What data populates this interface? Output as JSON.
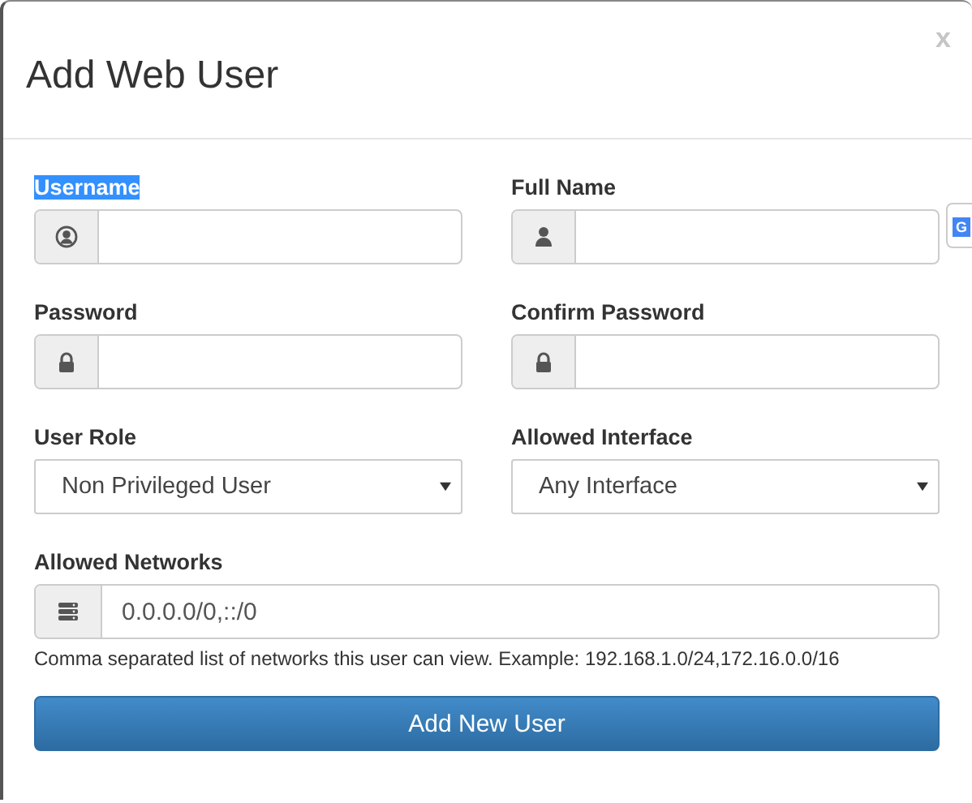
{
  "dialog": {
    "title": "Add Web User",
    "close": "x"
  },
  "fields": [
    {
      "kind": "input",
      "label": "Username",
      "label_highlighted": true
    },
    {
      "kind": "input",
      "label": "Full Name",
      "label_highlighted": false
    },
    {
      "kind": "input",
      "label": "Password",
      "label_highlighted": false
    },
    {
      "kind": "input",
      "label": "Confirm Password",
      "label_highlighted": false
    },
    {
      "kind": "select",
      "label": "User Role",
      "label_highlighted": false,
      "value": "Non Privileged User"
    },
    {
      "kind": "select",
      "label": "Allowed Interface",
      "label_highlighted": false,
      "value": "Any Interface"
    }
  ],
  "networks": {
    "label": "Allowed Networks",
    "label_highlighted": false,
    "value": "0.0.0.0/0,::/0",
    "help": "Comma separated list of networks this user can view. Example: 192.168.1.0/24,172.16.0.0/16"
  },
  "submit_button": "Add New User",
  "extension_badge": {
    "text": "G"
  }
}
